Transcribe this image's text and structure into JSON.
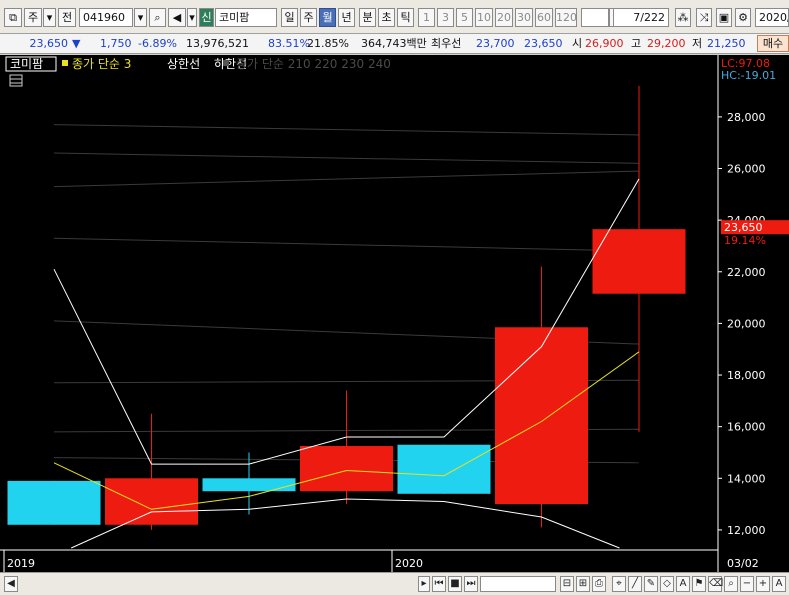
{
  "toolbar": {
    "market": "주",
    "prefix": "전",
    "code": "041960",
    "badge": "신",
    "name": "코미팜",
    "periods": [
      "일",
      "주",
      "월",
      "년",
      "분",
      "초",
      "틱"
    ],
    "active_period": "월",
    "intervals": [
      "1",
      "3",
      "5",
      "10",
      "20",
      "30",
      "60",
      "120"
    ],
    "count": "7/222",
    "date": "2020/"
  },
  "quote": {
    "price": "23,650",
    "arrow": "▼",
    "change": "1,750",
    "change_pct": "-6.89%",
    "volume": "13,976,521",
    "ratio1": "83.51%",
    "ratio2": "21.85%",
    "amount": "364,743백만",
    "best_label": "최우선",
    "best_ask": "23,700",
    "best_bid": "23,650",
    "open_label": "시",
    "open": "26,900",
    "high_label": "고",
    "high": "29,200",
    "low_label": "저",
    "low": "21,250",
    "trade_btn": "매수"
  },
  "legend": {
    "stock": "코미팜",
    "ma": "종가 단순 3",
    "upper": "상한선",
    "lower": "하한선",
    "long_ma": "종가 단순 210 220 230 240"
  },
  "readout": {
    "lc": "LC:97.08",
    "hc": "HC:-19.01",
    "current_price": "23,650",
    "current_pct": "19.14%"
  },
  "chart_data": {
    "type": "candlestick",
    "title": "",
    "y_ticks": [
      12000,
      14000,
      16000,
      18000,
      20000,
      22000,
      24000,
      26000,
      28000
    ],
    "y_tick_labels": [
      "12,000",
      "14,000",
      "16,000",
      "18,000",
      "20,000",
      "22,000",
      "24,000",
      "26,000",
      "28,000"
    ],
    "ylim": [
      11300,
      29700
    ],
    "x_labels": [
      "2019",
      "2020",
      "03/02"
    ],
    "candles": [
      {
        "open": 13900,
        "close": 12200,
        "high": 13900,
        "low": 12200,
        "color": "#22d3f0"
      },
      {
        "open": 12200,
        "close": 14000,
        "high": 16500,
        "low": 12000,
        "color": "#ee1c10"
      },
      {
        "open": 14000,
        "close": 13500,
        "high": 15000,
        "low": 12600,
        "color": "#22d3f0"
      },
      {
        "open": 13500,
        "close": 15250,
        "high": 17400,
        "low": 13000,
        "color": "#ee1c10"
      },
      {
        "open": 15300,
        "close": 13400,
        "high": 15300,
        "low": 13400,
        "color": "#22d3f0"
      },
      {
        "open": 13000,
        "close": 19850,
        "high": 22200,
        "low": 12100,
        "color": "#ee1c10"
      },
      {
        "open": 21150,
        "close": 23650,
        "high": 29200,
        "low": 15800,
        "color": "#ee1c10"
      }
    ],
    "series": [
      {
        "name": "종가 단순 3",
        "color": "#e8e020",
        "values": [
          14600,
          12800,
          13300,
          14300,
          14100,
          16200,
          18900
        ]
      },
      {
        "name": "상한선",
        "color": "#ffffff",
        "values": [
          22100,
          14550,
          14550,
          15600,
          15600,
          19100,
          25600
        ]
      },
      {
        "name": "하한선",
        "color": "#ffffff",
        "values": [
          11000,
          12700,
          12800,
          13200,
          13100,
          12500,
          11000
        ]
      }
    ],
    "long_ma_lines": [
      [
        27700,
        27300
      ],
      [
        26600,
        26200
      ],
      [
        25300,
        25900
      ],
      [
        23300,
        22800
      ],
      [
        20100,
        19200
      ],
      [
        17700,
        17800
      ],
      [
        15800,
        15900
      ],
      [
        14800,
        14600
      ]
    ],
    "colors": {
      "up": "#ee1c10",
      "down": "#22d3f0",
      "axis": "#ffffff",
      "readout": "#ee1c10"
    }
  }
}
